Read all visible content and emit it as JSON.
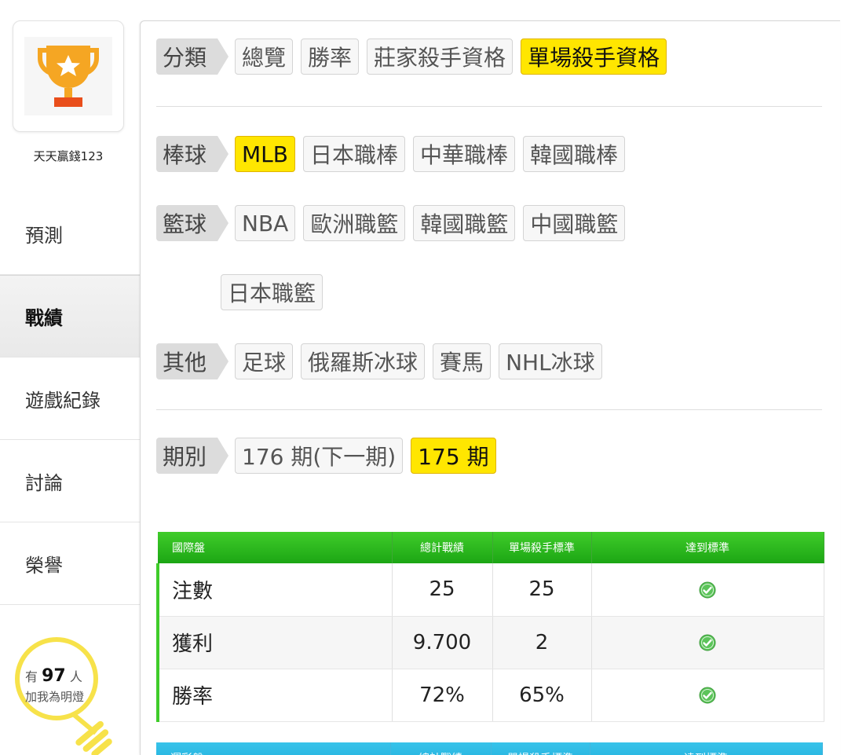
{
  "sidebar": {
    "username": "天天贏錢123",
    "nav": [
      {
        "label": "預測"
      },
      {
        "label": "戰績"
      },
      {
        "label": "遊戲紀錄"
      },
      {
        "label": "討論"
      },
      {
        "label": "榮譽"
      }
    ],
    "bulb": {
      "prefix": "有",
      "count": "97",
      "suffix": "人",
      "line2": "加我為明燈"
    }
  },
  "filters": {
    "category": {
      "label": "分類",
      "options": [
        "總覽",
        "勝率",
        "莊家殺手資格",
        "單場殺手資格"
      ],
      "selected": "單場殺手資格"
    },
    "baseball": {
      "label": "棒球",
      "options": [
        "MLB",
        "日本職棒",
        "中華職棒",
        "韓國職棒"
      ],
      "selected": "MLB"
    },
    "basketball": {
      "label": "籃球",
      "options": [
        "NBA",
        "歐洲職籃",
        "韓國職籃",
        "中國職籃",
        "日本職籃"
      ]
    },
    "other": {
      "label": "其他",
      "options": [
        "足球",
        "俄羅斯冰球",
        "賽馬",
        "NHL冰球"
      ]
    },
    "period": {
      "label": "期別",
      "options": [
        "176 期(下一期)",
        "175 期"
      ],
      "selected": "175 期"
    }
  },
  "table": {
    "headers": [
      "國際盤",
      "總計戰績",
      "單場殺手標準",
      "達到標準"
    ],
    "rows": [
      {
        "label": "注數",
        "total": "25",
        "standard": "25",
        "met": true
      },
      {
        "label": "獲利",
        "total": "9.700",
        "standard": "2",
        "met": true
      },
      {
        "label": "勝率",
        "total": "72%",
        "standard": "65%",
        "met": true
      }
    ]
  },
  "table2": {
    "headers": [
      "運彩盤",
      "總計戰績",
      "單場殺手標準",
      "達到標準"
    ]
  },
  "colors": {
    "selected": "#ffe600",
    "table_header_green": "#22ab18",
    "table_header_blue": "#1aa9d8",
    "check_green": "#5cc45a"
  }
}
